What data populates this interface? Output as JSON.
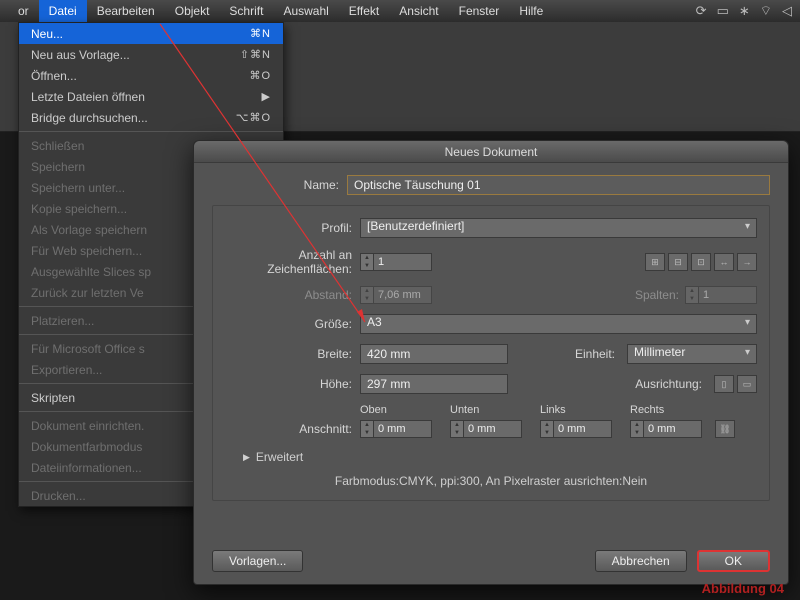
{
  "menubar": {
    "items": [
      "Datei",
      "Bearbeiten",
      "Objekt",
      "Schrift",
      "Auswahl",
      "Effekt",
      "Ansicht",
      "Fenster",
      "Hilfe"
    ]
  },
  "dropdown": {
    "g1": [
      {
        "label": "Neu...",
        "kbd": "⌘N",
        "sel": true
      },
      {
        "label": "Neu aus Vorlage...",
        "kbd": "⇧⌘N"
      },
      {
        "label": "Öffnen...",
        "kbd": "⌘O"
      },
      {
        "label": "Letzte Dateien öffnen",
        "kbd": "▶"
      },
      {
        "label": "Bridge durchsuchen...",
        "kbd": "⌥⌘O"
      }
    ],
    "g2": [
      {
        "label": "Schließen",
        "disabled": true
      },
      {
        "label": "Speichern",
        "disabled": true
      },
      {
        "label": "Speichern unter...",
        "disabled": true
      },
      {
        "label": "Kopie speichern...",
        "disabled": true
      },
      {
        "label": "Als Vorlage speichern",
        "disabled": true
      },
      {
        "label": "Für Web speichern...",
        "disabled": true
      },
      {
        "label": "Ausgewählte Slices sp",
        "disabled": true
      },
      {
        "label": "Zurück zur letzten Ve",
        "disabled": true
      }
    ],
    "g3": [
      {
        "label": "Platzieren...",
        "disabled": true
      }
    ],
    "g4": [
      {
        "label": "Für Microsoft Office s",
        "disabled": true
      },
      {
        "label": "Exportieren...",
        "disabled": true
      }
    ],
    "g5": [
      {
        "label": "Skripten"
      }
    ],
    "g6": [
      {
        "label": "Dokument einrichten.",
        "disabled": true
      },
      {
        "label": "Dokumentfarbmodus",
        "disabled": true
      },
      {
        "label": "Dateiinformationen...",
        "disabled": true
      }
    ],
    "g7": [
      {
        "label": "Drucken...",
        "disabled": true
      }
    ]
  },
  "dialog": {
    "title": "Neues Dokument",
    "name_label": "Name:",
    "name_value": "Optische Täuschung 01",
    "profile_label": "Profil:",
    "profile_value": "[Benutzerdefiniert]",
    "artboards_label": "Anzahl an Zeichenflächen:",
    "artboards_value": "1",
    "spacing_label": "Abstand:",
    "spacing_value": "7,06 mm",
    "columns_label": "Spalten:",
    "columns_value": "1",
    "size_label": "Größe:",
    "size_value": "A3",
    "width_label": "Breite:",
    "width_value": "420 mm",
    "units_label": "Einheit:",
    "units_value": "Millimeter",
    "height_label": "Höhe:",
    "height_value": "297 mm",
    "orient_label": "Ausrichtung:",
    "bleed_label": "Anschnitt:",
    "bleed_top": "Oben",
    "bleed_bottom": "Unten",
    "bleed_left": "Links",
    "bleed_right": "Rechts",
    "bleed_val": "0 mm",
    "advanced": "Erweitert",
    "summary": "Farbmodus:CMYK, ppi:300, An Pixelraster ausrichten:Nein",
    "templates": "Vorlagen...",
    "cancel": "Abbrechen",
    "ok": "OK"
  },
  "caption": "Abbildung  04"
}
